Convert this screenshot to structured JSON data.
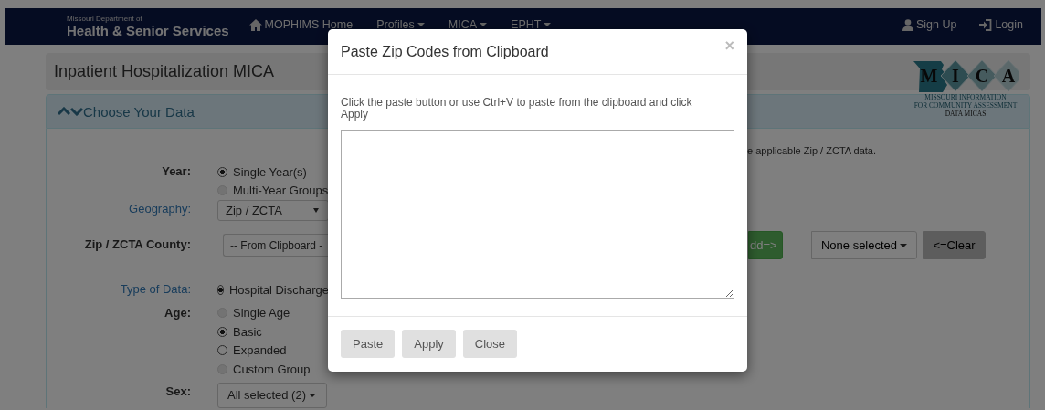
{
  "navbar": {
    "brand_small": "Missouri Department of",
    "brand": "Health & Senior Services",
    "items": [
      {
        "label": "MOPHIMS Home",
        "kind": "home"
      },
      {
        "label": "Profiles",
        "kind": "dropdown"
      },
      {
        "label": "MICA",
        "kind": "dropdown"
      },
      {
        "label": "EPHT",
        "kind": "dropdown"
      }
    ],
    "right_items": [
      {
        "label": "Sign Up",
        "kind": "signup"
      },
      {
        "label": "Login",
        "kind": "login"
      }
    ]
  },
  "page_title": "Inpatient Hospitalization MICA",
  "logo": {
    "letters": [
      "M",
      "I",
      "C",
      "A"
    ],
    "lines": [
      "MISSOURI INFORMATION",
      "FOR COMMUNITY ASSESSMENT",
      "DATA MICAS"
    ]
  },
  "section": {
    "title": "Choose Your Data",
    "note": "e applicable Zip / ZCTA data.",
    "fields": [
      {
        "label": "Year:",
        "link": false,
        "kind": "radio",
        "options": [
          {
            "label": "Single Year(s)",
            "selected": true,
            "disabled": false
          },
          {
            "label": "Multi-Year Groups",
            "selected": false,
            "disabled": true
          }
        ]
      },
      {
        "label": "Geography:",
        "link": true,
        "kind": "select",
        "value": "Zip / ZCTA"
      },
      {
        "label": "Zip / ZCTA County:",
        "link": false,
        "kind": "select",
        "value": "-- From Clipboard -",
        "buttons": [
          {
            "label": "dd=>",
            "kind": "add"
          },
          {
            "label": "None selected",
            "kind": "dropdown"
          },
          {
            "label": "<=Clear",
            "kind": "clear"
          }
        ]
      },
      {
        "label": "Type of Data:",
        "link": true,
        "kind": "radio",
        "options": [
          {
            "label": "Hospital Discharge",
            "selected": true,
            "disabled": false
          }
        ]
      },
      {
        "label": "Age:",
        "link": false,
        "kind": "radio",
        "options": [
          {
            "label": "Single Age",
            "selected": false,
            "disabled": true
          },
          {
            "label": "Basic",
            "selected": true,
            "disabled": false
          },
          {
            "label": "Expanded",
            "selected": false,
            "disabled": false
          },
          {
            "label": "Custom Group",
            "selected": false,
            "disabled": true
          }
        ]
      },
      {
        "label": "Sex:",
        "link": false,
        "kind": "dropdown",
        "value": "All selected (2)"
      }
    ]
  },
  "modal": {
    "title": "Paste Zip Codes from Clipboard",
    "close": "×",
    "instructions": "Click the paste button or use Ctrl+V to paste from the clipboard and click Apply",
    "buttons": [
      "Paste",
      "Apply",
      "Close"
    ]
  }
}
